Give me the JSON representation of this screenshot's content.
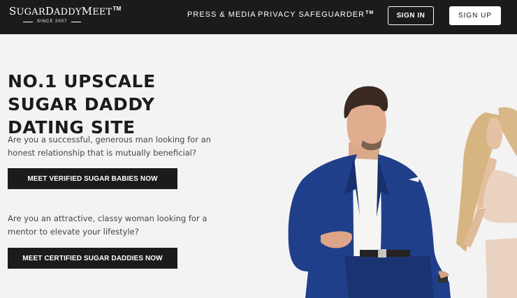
{
  "header": {
    "logo": {
      "part1": "S",
      "part2": "UGAR",
      "part3": "D",
      "part4": "ADDY",
      "part5": "M",
      "part6": "EET",
      "tm": "TM",
      "since": "SINCE 2007"
    },
    "nav": {
      "press": "PRESS & MEDIA",
      "privacy": "PRIVACY SAFEGUARDER",
      "privacy_tm": "TM"
    },
    "signin_label": "SIGN IN",
    "signup_label": "SIGN UP"
  },
  "hero": {
    "title": "NO.1 UPSCALE SUGAR DADDY DATING SITE",
    "text_men": "Are you a successful, generous man looking for an honest relationship that is mutually beneficial?",
    "cta_babies": "MEET VERIFIED SUGAR BABIES NOW",
    "text_women": "Are you an attractive, classy woman looking for a mentor to elevate your lifestyle?",
    "cta_daddies": "MEET CERTIFIED SUGAR DADDIES NOW"
  },
  "colors": {
    "header_bg": "#1b1b1b",
    "page_bg": "#f4f3f3",
    "cta_bg": "#1b1b1b",
    "suit": "#1f3f8a"
  },
  "icons": {
    "hero_photo": "couple-photo"
  }
}
